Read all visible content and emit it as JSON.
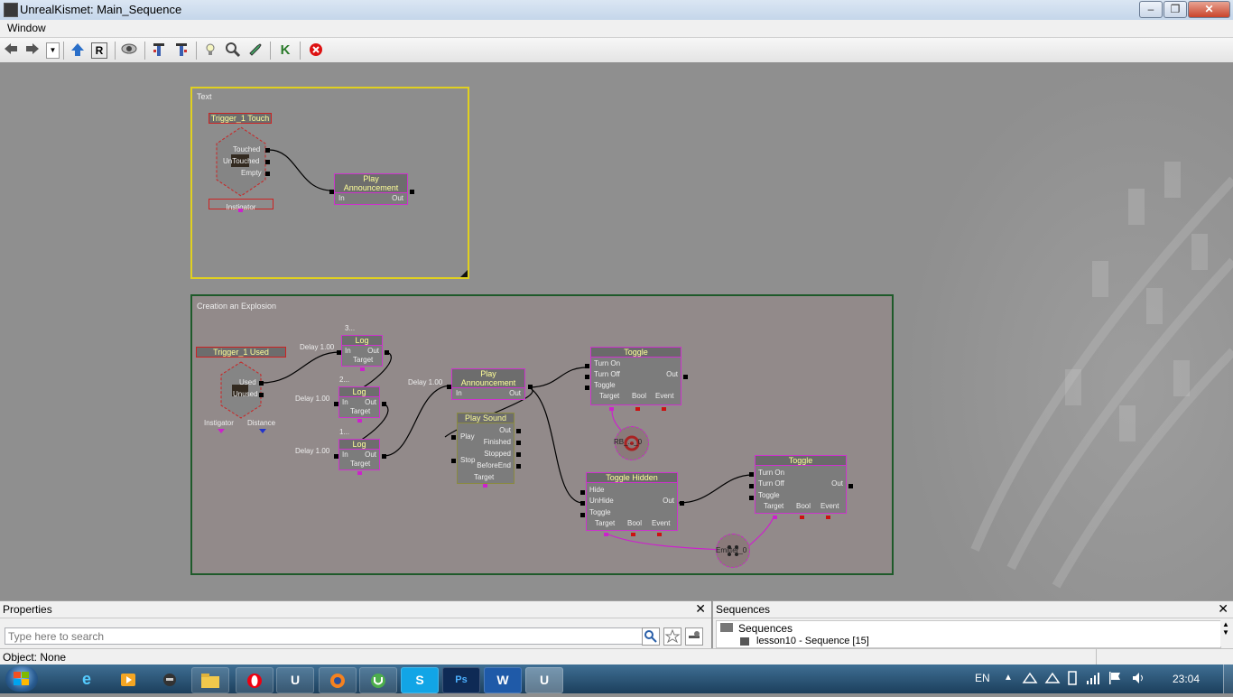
{
  "window": {
    "title": "UnrealKismet: Main_Sequence",
    "controls": {
      "minimize": "‒",
      "maximize": "❐",
      "close": "✕"
    }
  },
  "menubar": {
    "items": [
      "Window"
    ]
  },
  "toolbar": {
    "buttons": [
      "back-arrow-icon",
      "forward-arrow-icon",
      "dropdown-icon",
      "parent-sequence-icon",
      "rename-icon",
      "visibility-eye-icon",
      "search-up-icon",
      "search-down-icon",
      "lightbulb-icon",
      "zoom-icon",
      "wrench-icon",
      "kismet-k-icon",
      "stop-icon"
    ],
    "k_label": "K",
    "r_label": "R"
  },
  "canvas": {
    "comments": [
      {
        "title": "Text",
        "border": "#e0d020"
      },
      {
        "title": "Creation an Explosion",
        "border": "#1e5a2a"
      }
    ],
    "nodes": {
      "trigger_touch": {
        "title": "Trigger_1 Touch",
        "outputs": [
          "Touched",
          "UnTouched",
          "Empty"
        ],
        "var": "Instigator"
      },
      "play_announcement_1": {
        "title": "Play Announcement",
        "in": "In",
        "out": "Out"
      },
      "trigger_used": {
        "title": "Trigger_1 Used",
        "outputs": [
          "Used",
          "Unused"
        ],
        "vars": [
          "Instigator",
          "Distance"
        ]
      },
      "log_1": {
        "title": "Log",
        "caption": "3...",
        "in": "In",
        "out": "Out",
        "var": "Target",
        "delay": "Delay 1.00"
      },
      "log_2": {
        "title": "Log",
        "caption": "2...",
        "in": "In",
        "out": "Out",
        "var": "Target",
        "delay": "Delay 1.00"
      },
      "log_3": {
        "title": "Log",
        "caption": "1...",
        "in": "In",
        "out": "Out",
        "var": "Target",
        "delay": "Delay 1.00"
      },
      "play_announcement_2": {
        "title": "Play Announcement",
        "in": "In",
        "out": "Out",
        "delay": "Delay 1.00"
      },
      "play_sound": {
        "title": "Play Sound",
        "inputs": [
          "Play",
          "Stop"
        ],
        "outputs": [
          "Out",
          "Finished",
          "Stopped",
          "BeforeEnd"
        ],
        "var": "Target"
      },
      "toggle_1": {
        "title": "Toggle",
        "inputs": [
          "Turn On",
          "Turn Off",
          "Toggle"
        ],
        "out": "Out",
        "vars": [
          "Target",
          "Bool",
          "Event"
        ]
      },
      "toggle_hidden": {
        "title": "Toggle Hidden",
        "inputs": [
          "Hide",
          "UnHide",
          "Toggle"
        ],
        "out": "Out",
        "vars": [
          "Target",
          "Bool",
          "Event"
        ]
      },
      "toggle_2": {
        "title": "Toggle",
        "inputs": [
          "Turn On",
          "Turn Off",
          "Toggle"
        ],
        "out": "Out",
        "vars": [
          "Target",
          "Bool",
          "Event"
        ]
      },
      "rb_var": {
        "label": "RB_..._0"
      },
      "emitter_var": {
        "label": "Emitter_0"
      }
    }
  },
  "properties": {
    "title": "Properties",
    "search_placeholder": "Type here to search",
    "object_status": "Object: None"
  },
  "sequences": {
    "title": "Sequences",
    "root": "Sequences",
    "child": "lesson10 - Sequence [15]"
  },
  "taskbar": {
    "apps": [
      "internet-explorer-icon",
      "media-player-icon",
      "game-icon",
      "folder-icon",
      "opera-icon",
      "unreal-icon",
      "firefox-icon",
      "utorrent-icon",
      "skype-icon",
      "photoshop-icon",
      "word-icon",
      "unreal-editor-icon"
    ],
    "labels": {
      "unreal": "U",
      "ps": "Ps",
      "word": "W",
      "skype": "S"
    },
    "language": "EN",
    "clock": "23:04"
  }
}
